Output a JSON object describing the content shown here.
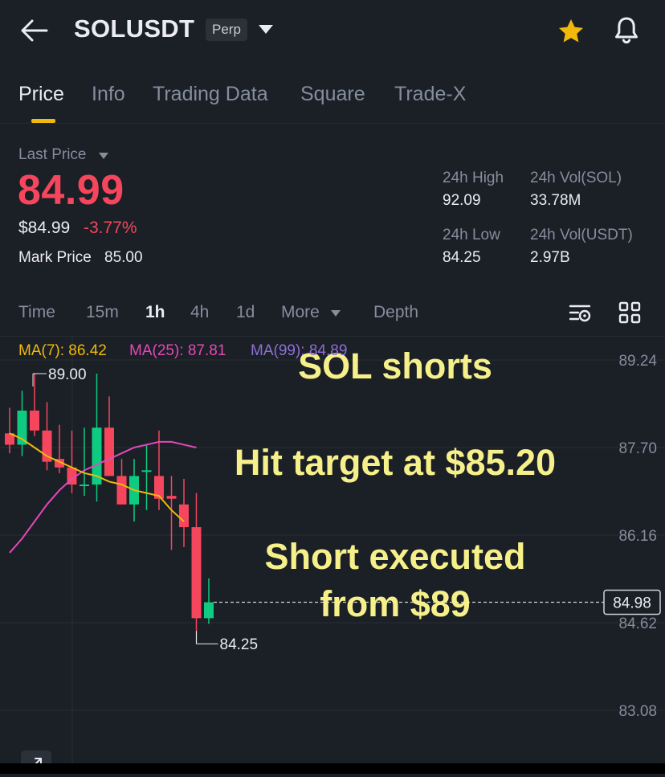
{
  "header": {
    "symbol": "SOLUSDT",
    "badge": "Perp",
    "icons": {
      "back": "back-arrow-icon",
      "dropdown": "caret-down-icon",
      "favorite": "star-icon",
      "alerts": "bell-icon"
    },
    "colors": {
      "star": "#f0b90b"
    }
  },
  "tabs": [
    {
      "label": "Price",
      "active": true
    },
    {
      "label": "Info"
    },
    {
      "label": "Trading Data"
    },
    {
      "label": "Square"
    },
    {
      "label": "Trade-X"
    }
  ],
  "price": {
    "last_label": "Last Price",
    "last": "84.99",
    "usd": "$84.99",
    "change": "-3.77%",
    "mark_label": "Mark Price",
    "mark": "85.00",
    "colors": {
      "down": "#f6465d",
      "accent": "#f0b90b"
    }
  },
  "stats": {
    "high_label": "24h High",
    "high": "92.09",
    "vol_sol_label": "24h Vol(SOL)",
    "vol_sol": "33.78M",
    "low_label": "24h Low",
    "low": "84.25",
    "vol_usdt_label": "24h Vol(USDT)",
    "vol_usdt": "2.97B"
  },
  "timeframes": [
    {
      "label": "Time"
    },
    {
      "label": "15m"
    },
    {
      "label": "1h",
      "active": true
    },
    {
      "label": "4h"
    },
    {
      "label": "1d"
    },
    {
      "label": "More"
    },
    {
      "label": "Depth"
    }
  ],
  "indicators": {
    "ma7": "MA(7): 86.42",
    "ma25": "MA(25): 87.81",
    "ma99": "MA(99): 84.89",
    "colors": {
      "ma7": "#f0b90b",
      "ma25": "#e349b8",
      "ma99": "#8e6fd6"
    }
  },
  "chart_data": {
    "type": "candlestick",
    "y_ticks": [
      "89.24",
      "87.70",
      "86.16",
      "84.62",
      "83.08"
    ],
    "current_price_tag": "84.98",
    "high_marker": "89.00",
    "low_marker": "84.25",
    "candles": [
      {
        "o": 87.95,
        "h": 88.4,
        "l": 87.6,
        "c": 87.75
      },
      {
        "o": 87.75,
        "h": 88.7,
        "l": 87.55,
        "c": 88.35
      },
      {
        "o": 88.35,
        "h": 89.0,
        "l": 87.9,
        "c": 88.0
      },
      {
        "o": 88.0,
        "h": 88.5,
        "l": 87.3,
        "c": 87.45
      },
      {
        "o": 87.5,
        "h": 88.1,
        "l": 87.25,
        "c": 87.35
      },
      {
        "o": 87.35,
        "h": 88.0,
        "l": 86.9,
        "c": 87.05
      },
      {
        "o": 87.05,
        "h": 88.05,
        "l": 86.85,
        "c": 87.05
      },
      {
        "o": 87.05,
        "h": 89.0,
        "l": 86.75,
        "c": 88.05
      },
      {
        "o": 88.05,
        "h": 88.6,
        "l": 87.5,
        "c": 87.2
      },
      {
        "o": 87.2,
        "h": 87.5,
        "l": 86.7,
        "c": 86.7
      },
      {
        "o": 86.7,
        "h": 87.5,
        "l": 86.4,
        "c": 87.2
      },
      {
        "o": 87.3,
        "h": 87.75,
        "l": 86.6,
        "c": 87.3
      },
      {
        "o": 87.2,
        "h": 88.0,
        "l": 86.6,
        "c": 86.8
      },
      {
        "o": 86.85,
        "h": 87.2,
        "l": 85.9,
        "c": 86.8
      },
      {
        "o": 86.7,
        "h": 87.15,
        "l": 85.95,
        "c": 86.3
      },
      {
        "o": 86.3,
        "h": 86.9,
        "l": 84.25,
        "c": 84.7
      },
      {
        "o": 84.7,
        "h": 85.4,
        "l": 84.6,
        "c": 84.98
      }
    ],
    "ma7_series": [
      87.95,
      87.85,
      87.7,
      87.55,
      87.45,
      87.35,
      87.25,
      87.2,
      87.1,
      87.05,
      86.95,
      86.9,
      86.85,
      86.6,
      86.4
    ],
    "ma25_series": [
      85.85,
      86.1,
      86.4,
      86.7,
      86.95,
      87.15,
      87.3,
      87.4,
      87.5,
      87.6,
      87.7,
      87.75,
      87.8,
      87.8,
      87.75,
      87.7
    ],
    "colors": {
      "up": "#0ecb81",
      "down": "#f6465d",
      "grid": "#2a2f37"
    },
    "annotations": [
      "SOL shorts",
      "Hit target at $85.20",
      "Short executed",
      "from $89"
    ]
  },
  "footer": {
    "expand_icon": "expand-arrow-icon"
  }
}
